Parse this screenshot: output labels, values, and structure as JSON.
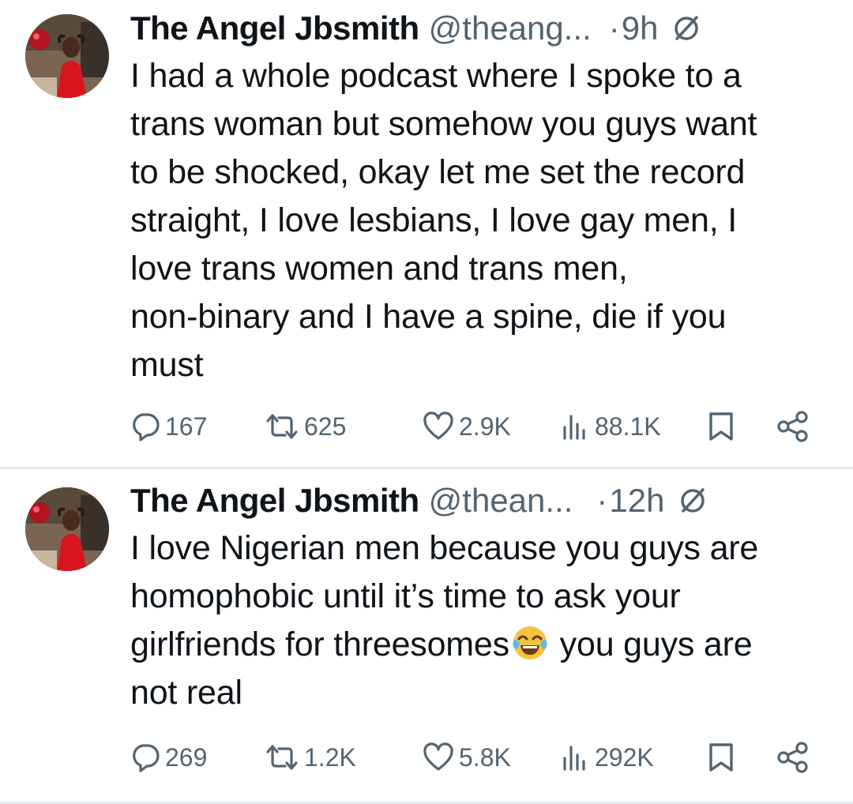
{
  "tweets": [
    {
      "display_name": "The Angel Jbsmith",
      "handle": "@theang...",
      "separator": "·",
      "time": "9h",
      "status_icon": "not-allowed-icon",
      "lines": [
        "I had a whole podcast where I spoke to a",
        "trans woman but somehow you guys want",
        "to be shocked, okay let me set the record",
        "straight, I love lesbians, I love gay men, I",
        "love trans women and trans men,",
        "non-binary and I have a spine, die if you",
        "must"
      ],
      "replies": "167",
      "retweets": "625",
      "likes": "2.9K",
      "views": "88.1K"
    },
    {
      "display_name": "The Angel Jbsmith",
      "handle": "@thean...",
      "separator": "·",
      "time": "12h",
      "status_icon": "not-allowed-icon",
      "lines": [
        "I love Nigerian men because you guys are",
        "homophobic until it’s time to ask your",
        "girlfriends for threesomes",
        " you guys are",
        "not real"
      ],
      "emoji": "face-with-tears-of-joy",
      "replies": "269",
      "retweets": "1.2K",
      "likes": "5.8K",
      "views": "292K"
    }
  ],
  "icons": {
    "reply": "reply-icon",
    "retweet": "retweet-icon",
    "like": "heart-icon",
    "views": "views-icon",
    "bookmark": "bookmark-icon",
    "share": "share-icon",
    "more": "more-icon"
  },
  "colors": {
    "text_primary": "#0f1419",
    "text_secondary": "#536471",
    "divider": "#e6e9ec",
    "emoji_face": "#f7c23d"
  }
}
